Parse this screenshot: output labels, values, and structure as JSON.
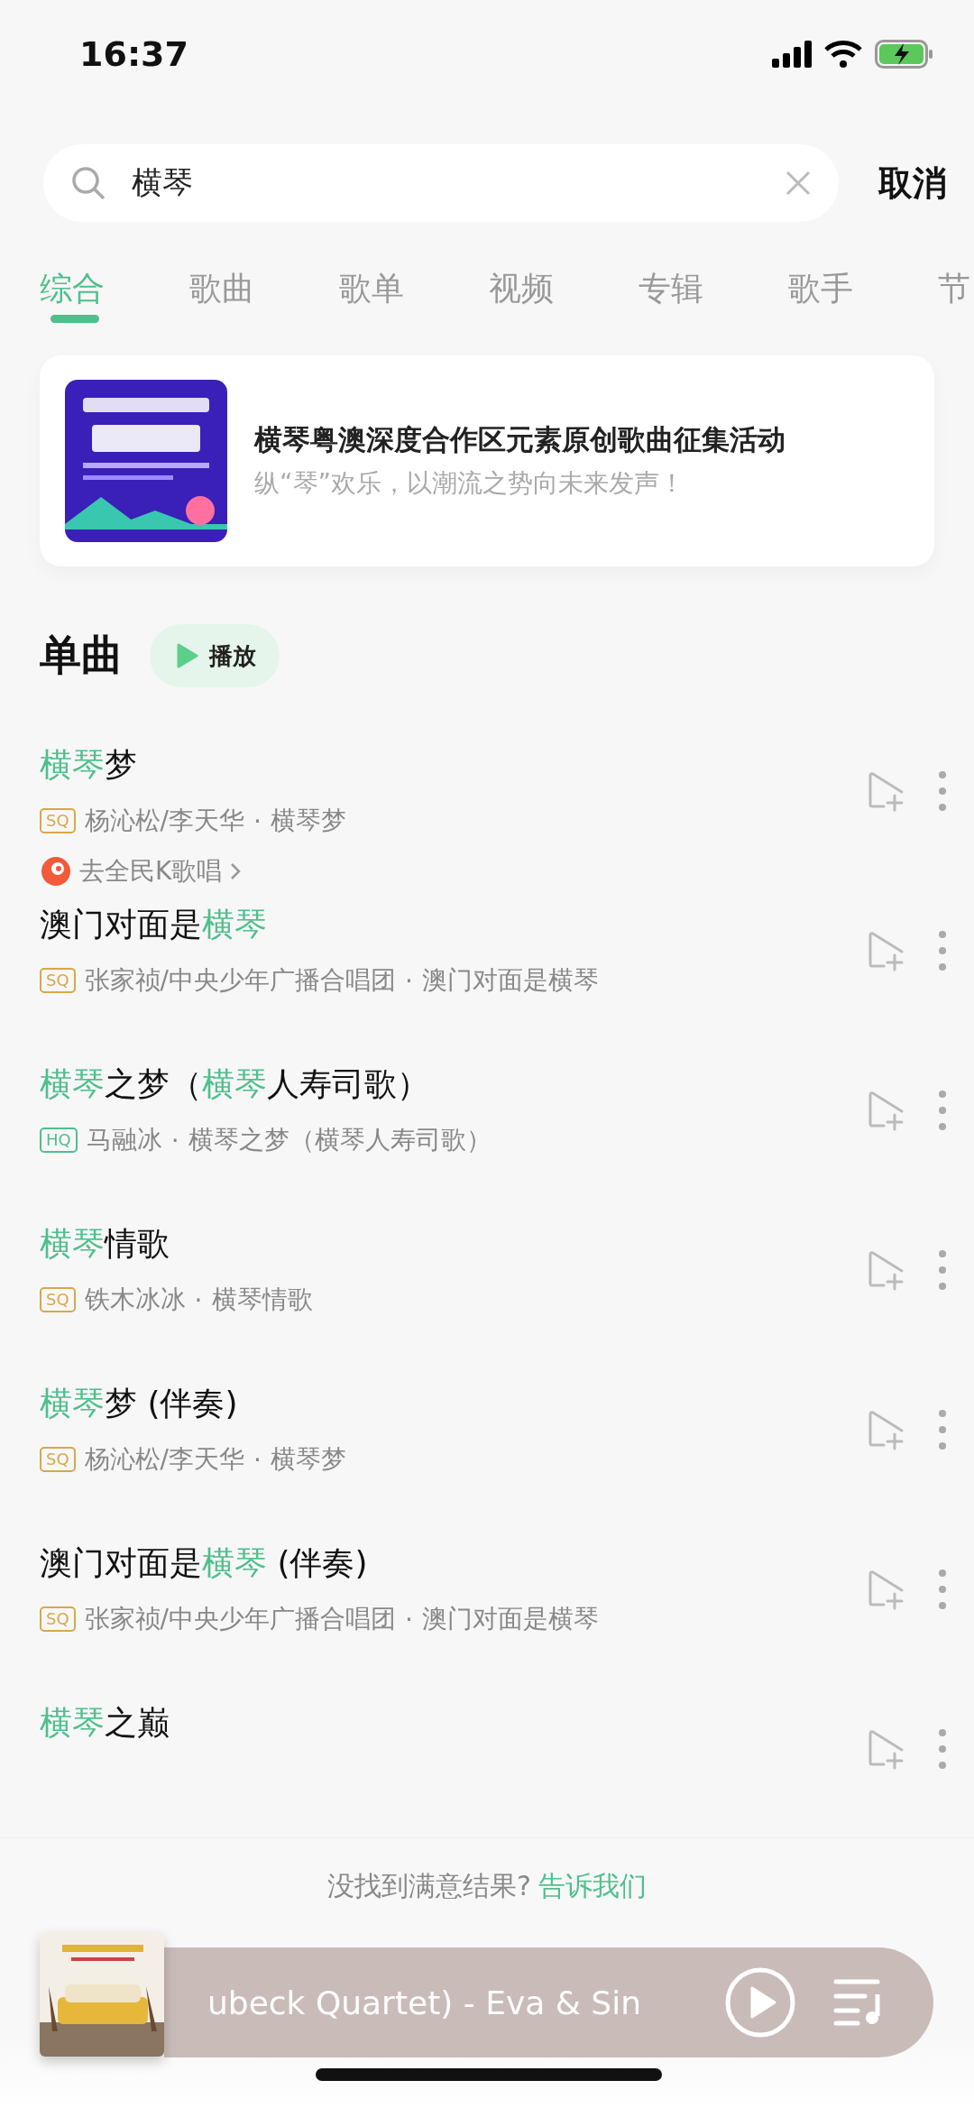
{
  "status_bar": {
    "time": "16:37"
  },
  "search": {
    "value": "横琴",
    "cancel": "取消"
  },
  "tabs": [
    {
      "label": "综合",
      "selected": true
    },
    {
      "label": "歌曲",
      "selected": false
    },
    {
      "label": "歌单",
      "selected": false
    },
    {
      "label": "视频",
      "selected": false
    },
    {
      "label": "专辑",
      "selected": false
    },
    {
      "label": "歌手",
      "selected": false
    },
    {
      "label": "节",
      "selected": false
    }
  ],
  "banner": {
    "title": "横琴粤澳深度合作区元素原创歌曲征集活动",
    "subtitle": "纵“琴”欢乐，以潮流之势向未来发声！"
  },
  "section": {
    "title": "单曲",
    "play": "播放"
  },
  "songs": [
    {
      "title": [
        {
          "text": "横琴",
          "highlight": true
        },
        {
          "text": "梦",
          "highlight": false
        }
      ],
      "quality": "SQ",
      "artists": "杨沁松/李天华",
      "separator": "·",
      "album": "横琴梦",
      "karaoke": "去全民K歌唱"
    },
    {
      "title": [
        {
          "text": "澳门对面是",
          "highlight": false
        },
        {
          "text": "横琴",
          "highlight": true
        }
      ],
      "quality": "SQ",
      "artists": "张家祯/中央少年广播合唱团",
      "separator": "·",
      "album": "澳门对面是横琴"
    },
    {
      "title": [
        {
          "text": "横琴",
          "highlight": true
        },
        {
          "text": "之梦（",
          "highlight": false
        },
        {
          "text": "横琴",
          "highlight": true
        },
        {
          "text": "人寿司歌）",
          "highlight": false
        }
      ],
      "quality": "HQ",
      "artists": "马融冰",
      "separator": "·",
      "album": "横琴之梦（横琴人寿司歌）"
    },
    {
      "title": [
        {
          "text": "横琴",
          "highlight": true
        },
        {
          "text": "情歌",
          "highlight": false
        }
      ],
      "quality": "SQ",
      "artists": "铁木冰冰",
      "separator": "·",
      "album": "横琴情歌"
    },
    {
      "title": [
        {
          "text": "横琴",
          "highlight": true
        },
        {
          "text": "梦 (伴奏)",
          "highlight": false
        }
      ],
      "quality": "SQ",
      "artists": "杨沁松/李天华",
      "separator": "·",
      "album": "横琴梦"
    },
    {
      "title": [
        {
          "text": "澳门对面是",
          "highlight": false
        },
        {
          "text": "横琴",
          "highlight": true
        },
        {
          "text": " (伴奏)",
          "highlight": false
        }
      ],
      "quality": "SQ",
      "artists": "张家祯/中央少年广播合唱团",
      "separator": "·",
      "album": "澳门对面是横琴"
    },
    {
      "title": [
        {
          "text": "横琴",
          "highlight": true
        },
        {
          "text": "之巅",
          "highlight": false
        }
      ]
    }
  ],
  "feedback": {
    "text": "没找到满意结果?",
    "link": "告诉我们"
  },
  "player": {
    "track": "ubeck Quartet) - Eva & Sin"
  }
}
